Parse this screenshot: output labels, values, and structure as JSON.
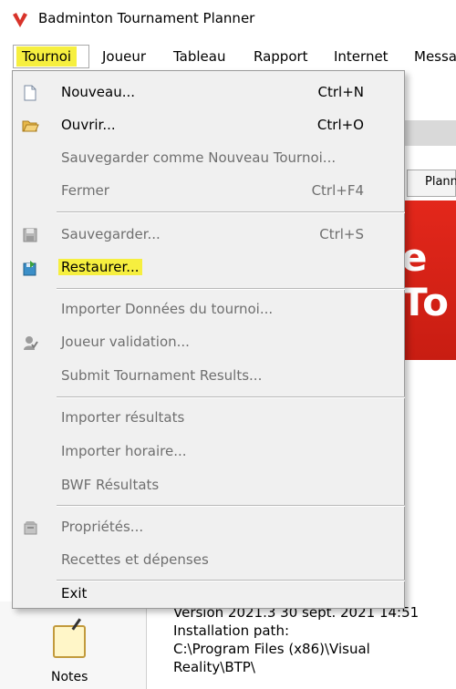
{
  "window": {
    "title": "Badminton Tournament Planner"
  },
  "menubar": [
    {
      "label": "Tournoi",
      "active": true
    },
    {
      "label": "Joueur"
    },
    {
      "label": "Tableau"
    },
    {
      "label": "Rapport"
    },
    {
      "label": "Internet"
    },
    {
      "label": "Messa"
    }
  ],
  "dropdown": {
    "items": [
      {
        "label": "Nouveau...",
        "shortcut": "Ctrl+N",
        "icon": "new-document-icon"
      },
      {
        "label": "Ouvrir...",
        "shortcut": "Ctrl+O",
        "icon": "open-folder-icon"
      },
      {
        "label": "Sauvegarder comme Nouveau Tournoi...",
        "shortcut": "",
        "disabled": true
      },
      {
        "label": "Fermer",
        "shortcut": "Ctrl+F4",
        "disabled": true
      },
      {
        "label": "Sauvegarder...",
        "shortcut": "Ctrl+S",
        "disabled": true,
        "icon": "save-icon"
      },
      {
        "label": "Restaurer...",
        "shortcut": "",
        "icon": "restore-icon",
        "highlighted": true
      },
      {
        "label": "Importer Données du tournoi...",
        "shortcut": "",
        "disabled": true
      },
      {
        "label": "Joueur validation...",
        "shortcut": "",
        "disabled": true,
        "icon": "player-validation-icon"
      },
      {
        "label": "Submit Tournament Results...",
        "shortcut": "",
        "disabled": true
      },
      {
        "label": "Importer résultats",
        "shortcut": "",
        "disabled": true
      },
      {
        "label": "Importer horaire...",
        "shortcut": "",
        "disabled": true
      },
      {
        "label": "BWF Résultats",
        "shortcut": "",
        "disabled": true
      },
      {
        "label": "Propriétés...",
        "shortcut": "",
        "disabled": true,
        "icon": "properties-icon"
      },
      {
        "label": "Recettes et dépenses",
        "shortcut": "",
        "disabled": true
      },
      {
        "label": "Exit",
        "shortcut": ""
      }
    ]
  },
  "background": {
    "tab_label": "Plann",
    "banner_text": "e To",
    "notes_label": "Notes",
    "info_lines": [
      "Version 2021.3 30 sept. 2021 14:51",
      "Installation path:",
      "C:\\Program Files (x86)\\Visual",
      "Reality\\BTP\\"
    ]
  },
  "colors": {
    "highlight": "#f6ef3f",
    "banner": "#e3271b",
    "menu_bg": "#f0f0f0",
    "disabled_text": "#6f6f6f"
  }
}
